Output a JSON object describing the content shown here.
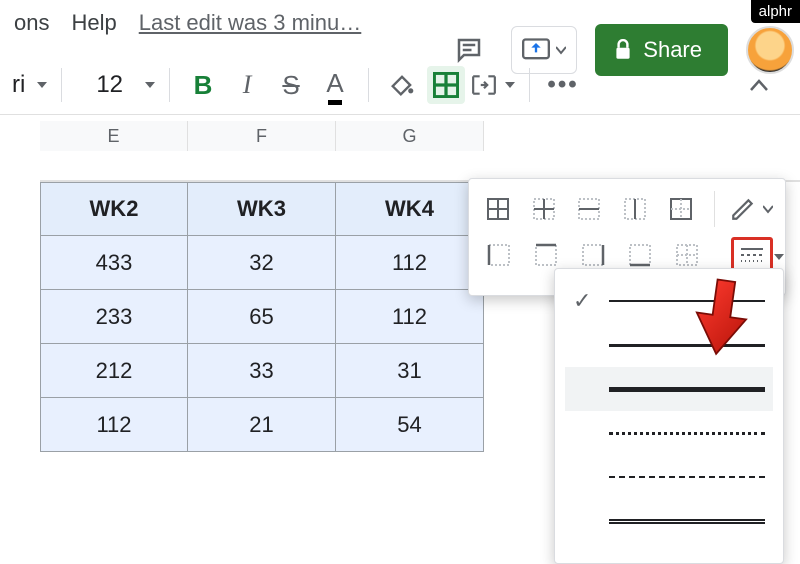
{
  "watermark": "alphr",
  "menubar": {
    "item1": "ons",
    "item2": "Help",
    "edit_status": "Last edit was 3 minu…"
  },
  "topbar": {
    "share_label": "Share"
  },
  "toolbar": {
    "font_name": "ri",
    "font_size": "12",
    "bold": "B",
    "italic": "I",
    "strike": "S",
    "text_color": "A",
    "more": "•••"
  },
  "columns": [
    "E",
    "F",
    "G"
  ],
  "table": {
    "headers": [
      "WK2",
      "WK3",
      "WK4"
    ],
    "rows": [
      [
        "433",
        "32",
        "112"
      ],
      [
        "233",
        "65",
        "112"
      ],
      [
        "212",
        "33",
        "31"
      ],
      [
        "112",
        "21",
        "54"
      ]
    ]
  },
  "border_styles": {
    "options": [
      "solid-thin",
      "solid-medium",
      "solid-thick",
      "dotted",
      "dashed",
      "double"
    ],
    "selected_index": 0,
    "hover_index": 2
  }
}
